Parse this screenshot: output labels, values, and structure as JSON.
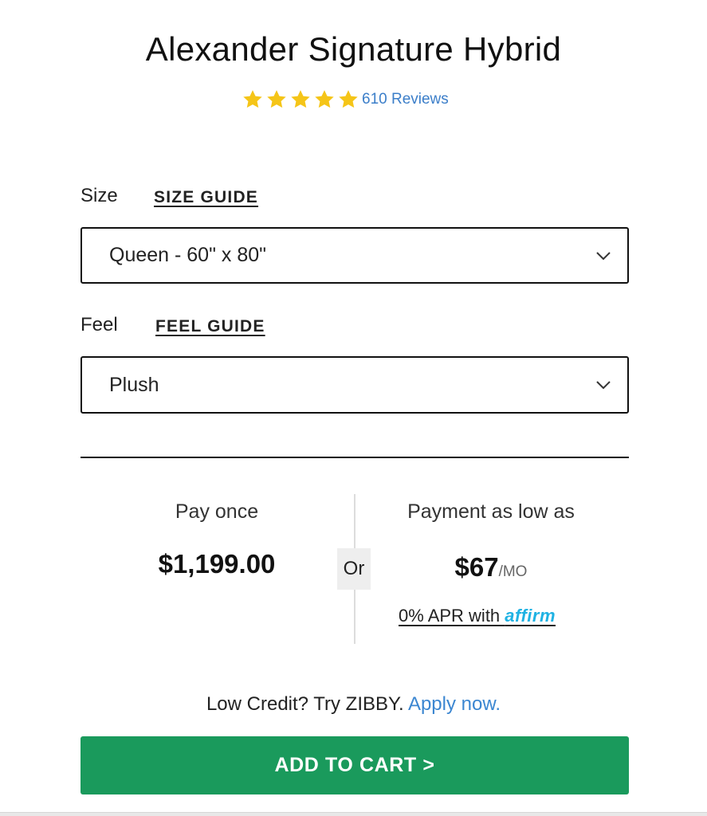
{
  "product": {
    "title": "Alexander Signature Hybrid",
    "rating": 5,
    "rating_max": 5,
    "reviews_label": "610 Reviews",
    "star_color": "#f5c518"
  },
  "size": {
    "label": "Size",
    "guide_label": "SIZE GUIDE",
    "selected": "Queen - 60\" x 80\""
  },
  "feel": {
    "label": "Feel",
    "guide_label": "FEEL GUIDE",
    "selected": "Plush"
  },
  "pricing": {
    "pay_once_label": "Pay once",
    "pay_once_price": "$1,199.00",
    "or_label": "Or",
    "payment_label": "Payment as low as",
    "monthly_price": "$67",
    "monthly_unit": "/MO",
    "apr_text": "0% APR with ",
    "affirm_brand": "affirm",
    "affirm_color": "#1fb2e3"
  },
  "financing": {
    "credit_text": "Low Credit? Try ZIBBY. ",
    "apply_label": "Apply now."
  },
  "cart": {
    "button_label": "ADD TO CART >",
    "button_color": "#1a9a5c"
  },
  "icons": {
    "star": "star-icon",
    "chevron": "chevron-down-icon"
  }
}
